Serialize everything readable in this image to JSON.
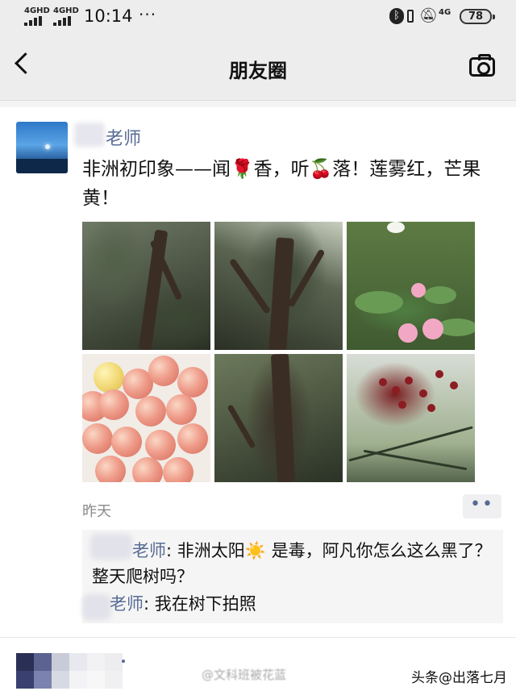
{
  "status_bar": {
    "signal_1": "4GHD",
    "signal_2": "4GHD",
    "time": "10:14",
    "more": "···",
    "net": "4G",
    "battery": "78"
  },
  "nav": {
    "title": "朋友圈"
  },
  "post": {
    "author": "老师",
    "text_parts": [
      "非洲初印象——闻",
      "🌹",
      "香，听",
      "🍒",
      "落！莲雾红，芒果黄！"
    ],
    "time": "昨天",
    "more_icon": "••"
  },
  "comments": [
    {
      "name": "老师",
      "sep": ": ",
      "text_a": "非洲太阳",
      "emoji": "☀️",
      "text_b": " 是毒，阿凡你怎么这么黑了？整天爬树吗？"
    },
    {
      "name": "老师",
      "sep": ": ",
      "text_a": "我在树下拍照"
    }
  ],
  "watermarks": {
    "center": "@文科班被花蓝",
    "right": "头条@出落七月"
  },
  "colors": {
    "link_blue": "#576b95",
    "bar_gray": "#ededed"
  },
  "icons": [
    "back-arrow-icon",
    "camera-icon",
    "bluetooth-icon",
    "mute-icon"
  ]
}
